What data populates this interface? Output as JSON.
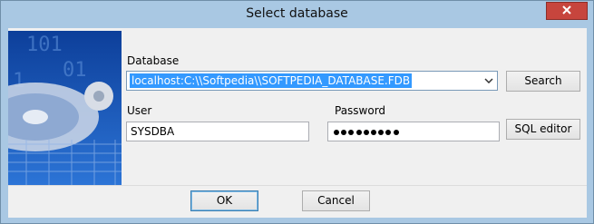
{
  "window": {
    "title": "Select database"
  },
  "form": {
    "database_label": "Database",
    "database_value": "localhost:C:\\\\Softpedia\\\\SOFTPEDIA_DATABASE.FDB",
    "user_label": "User",
    "user_value": "SYSDBA",
    "password_label": "Password",
    "password_length": 9
  },
  "buttons": {
    "search": "Search",
    "sql_editor": "SQL editor",
    "ok": "OK",
    "cancel": "Cancel"
  },
  "icons": {
    "close": "close-icon",
    "dropdown": "chevron-down-icon",
    "art": "database-disk-icon"
  },
  "colors": {
    "title_bar": "#a9c8e3",
    "close_button": "#c7453d",
    "selection": "#3399ff"
  }
}
